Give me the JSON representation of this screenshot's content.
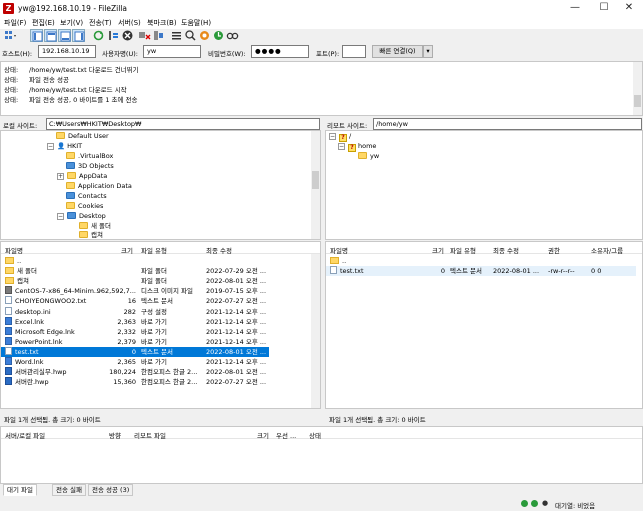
{
  "window": {
    "title": "yw@192.168.10.19 - FileZilla",
    "app_icon": "Z",
    "minimize": "—",
    "maximize": "☐",
    "close": "✕"
  },
  "menu": [
    "파일(F)",
    "편집(E)",
    "보기(V)",
    "전송(T)",
    "서버(S)",
    "북마크(B)",
    "도움말(H)"
  ],
  "quickconnect": {
    "host_label": "호스트(H):",
    "host_value": "192.168.10.19",
    "user_label": "사용자명(U):",
    "user_value": "yw",
    "pass_label": "비밀번호(W):",
    "pass_value": "●●●●",
    "port_label": "포트(P):",
    "port_value": "",
    "connect_label": "빠른 연결(Q)",
    "dropdown": "▾"
  },
  "log": [
    {
      "k": "상태:",
      "v": "/home/yw/test.txt 다운로드 건너뛰기"
    },
    {
      "k": "상태:",
      "v": "파일 전송 성공"
    },
    {
      "k": "상태:",
      "v": "/home/yw/test.txt 다운로드 시작"
    },
    {
      "k": "상태:",
      "v": "파일 전송 성공, 0 바이트를 1 초에 전송"
    }
  ],
  "local": {
    "site_label": "로컬 사이트:",
    "site_path": "C:₩Users₩HKIT₩Desktop₩",
    "tree": [
      "Default User",
      "HKIT",
      ".VirtualBox",
      "3D Objects",
      "AppData",
      "Application Data",
      "Contacts",
      "Cookies",
      "Desktop",
      "새 폴더",
      "캡쳐"
    ],
    "headers": {
      "name": "파일명",
      "size": "크기",
      "type": "파일 유형",
      "modified": "최종 수정"
    },
    "files": [
      {
        "name": "..",
        "size": "",
        "type": "",
        "modified": ""
      },
      {
        "name": "새 폴더",
        "size": "",
        "type": "파일 폴더",
        "modified": "2022-07-29 오전 ..."
      },
      {
        "name": "캡쳐",
        "size": "",
        "type": "파일 폴더",
        "modified": "2022-08-01 오전 ..."
      },
      {
        "name": "CentOS-7-x86_64-Minim...",
        "size": "962,592,7...",
        "type": "디스크 이미지 파일",
        "modified": "2019-07-15 오후 ..."
      },
      {
        "name": "CHOIYEONGWOO2.txt",
        "size": "16",
        "type": "텍스트 문서",
        "modified": "2022-07-27 오전 ..."
      },
      {
        "name": "desktop.ini",
        "size": "282",
        "type": "구성 설정",
        "modified": "2021-12-14 오후 ..."
      },
      {
        "name": "Excel.lnk",
        "size": "2,363",
        "type": "바로 가기",
        "modified": "2021-12-14 오후 ..."
      },
      {
        "name": "Microsoft Edge.lnk",
        "size": "2,332",
        "type": "바로 가기",
        "modified": "2021-12-14 오후 ..."
      },
      {
        "name": "PowerPoint.lnk",
        "size": "2,379",
        "type": "바로 가기",
        "modified": "2021-12-14 오후 ..."
      },
      {
        "name": "test.txt",
        "size": "0",
        "type": "텍스트 문서",
        "modified": "2022-08-01 오전 ..."
      },
      {
        "name": "Word.lnk",
        "size": "2,365",
        "type": "바로 가기",
        "modified": "2021-12-14 오후 ..."
      },
      {
        "name": "서버관리실무.hwp",
        "size": "180,224",
        "type": "한컴오피스 한글 2...",
        "modified": "2022-08-01 오전 ..."
      },
      {
        "name": "서버란.hwp",
        "size": "15,360",
        "type": "한컴오피스 한글 2...",
        "modified": "2022-07-27 오전 ..."
      }
    ],
    "selected_index": 9,
    "status": "파일 1개 선택됨. 총 크기: 0 바이트"
  },
  "remote": {
    "site_label": "리모트 사이트:",
    "site_path": "/home/yw",
    "tree": [
      "/",
      "home",
      "yw"
    ],
    "headers": {
      "name": "파일명",
      "size": "크기",
      "type": "파일 유형",
      "modified": "최종 수정",
      "perm": "권한",
      "owner": "소유자/그룹"
    },
    "files": [
      {
        "name": "..",
        "size": "",
        "type": "",
        "modified": "",
        "perm": "",
        "owner": ""
      },
      {
        "name": "test.txt",
        "size": "0",
        "type": "텍스트 문서",
        "modified": "2022-08-01 ...",
        "perm": "-rw-r--r--",
        "owner": "0 0"
      }
    ],
    "status": "파일 1개 선택됨. 총 크기: 0 바이트"
  },
  "queue": {
    "headers": {
      "file": "서버/로컬 파일",
      "dir": "방향",
      "remote": "리모트 파일",
      "size": "크기",
      "priority": "우선 ...",
      "status": "상태"
    },
    "tabs": [
      "대기 파일",
      "전송 실패",
      "전송 성공 (3)"
    ]
  },
  "statusbar": {
    "queue_text": "대기열: 비었음"
  },
  "colors": {
    "selection": "#0078d7",
    "folder": "#ffd766",
    "brand": "#bf0000"
  }
}
